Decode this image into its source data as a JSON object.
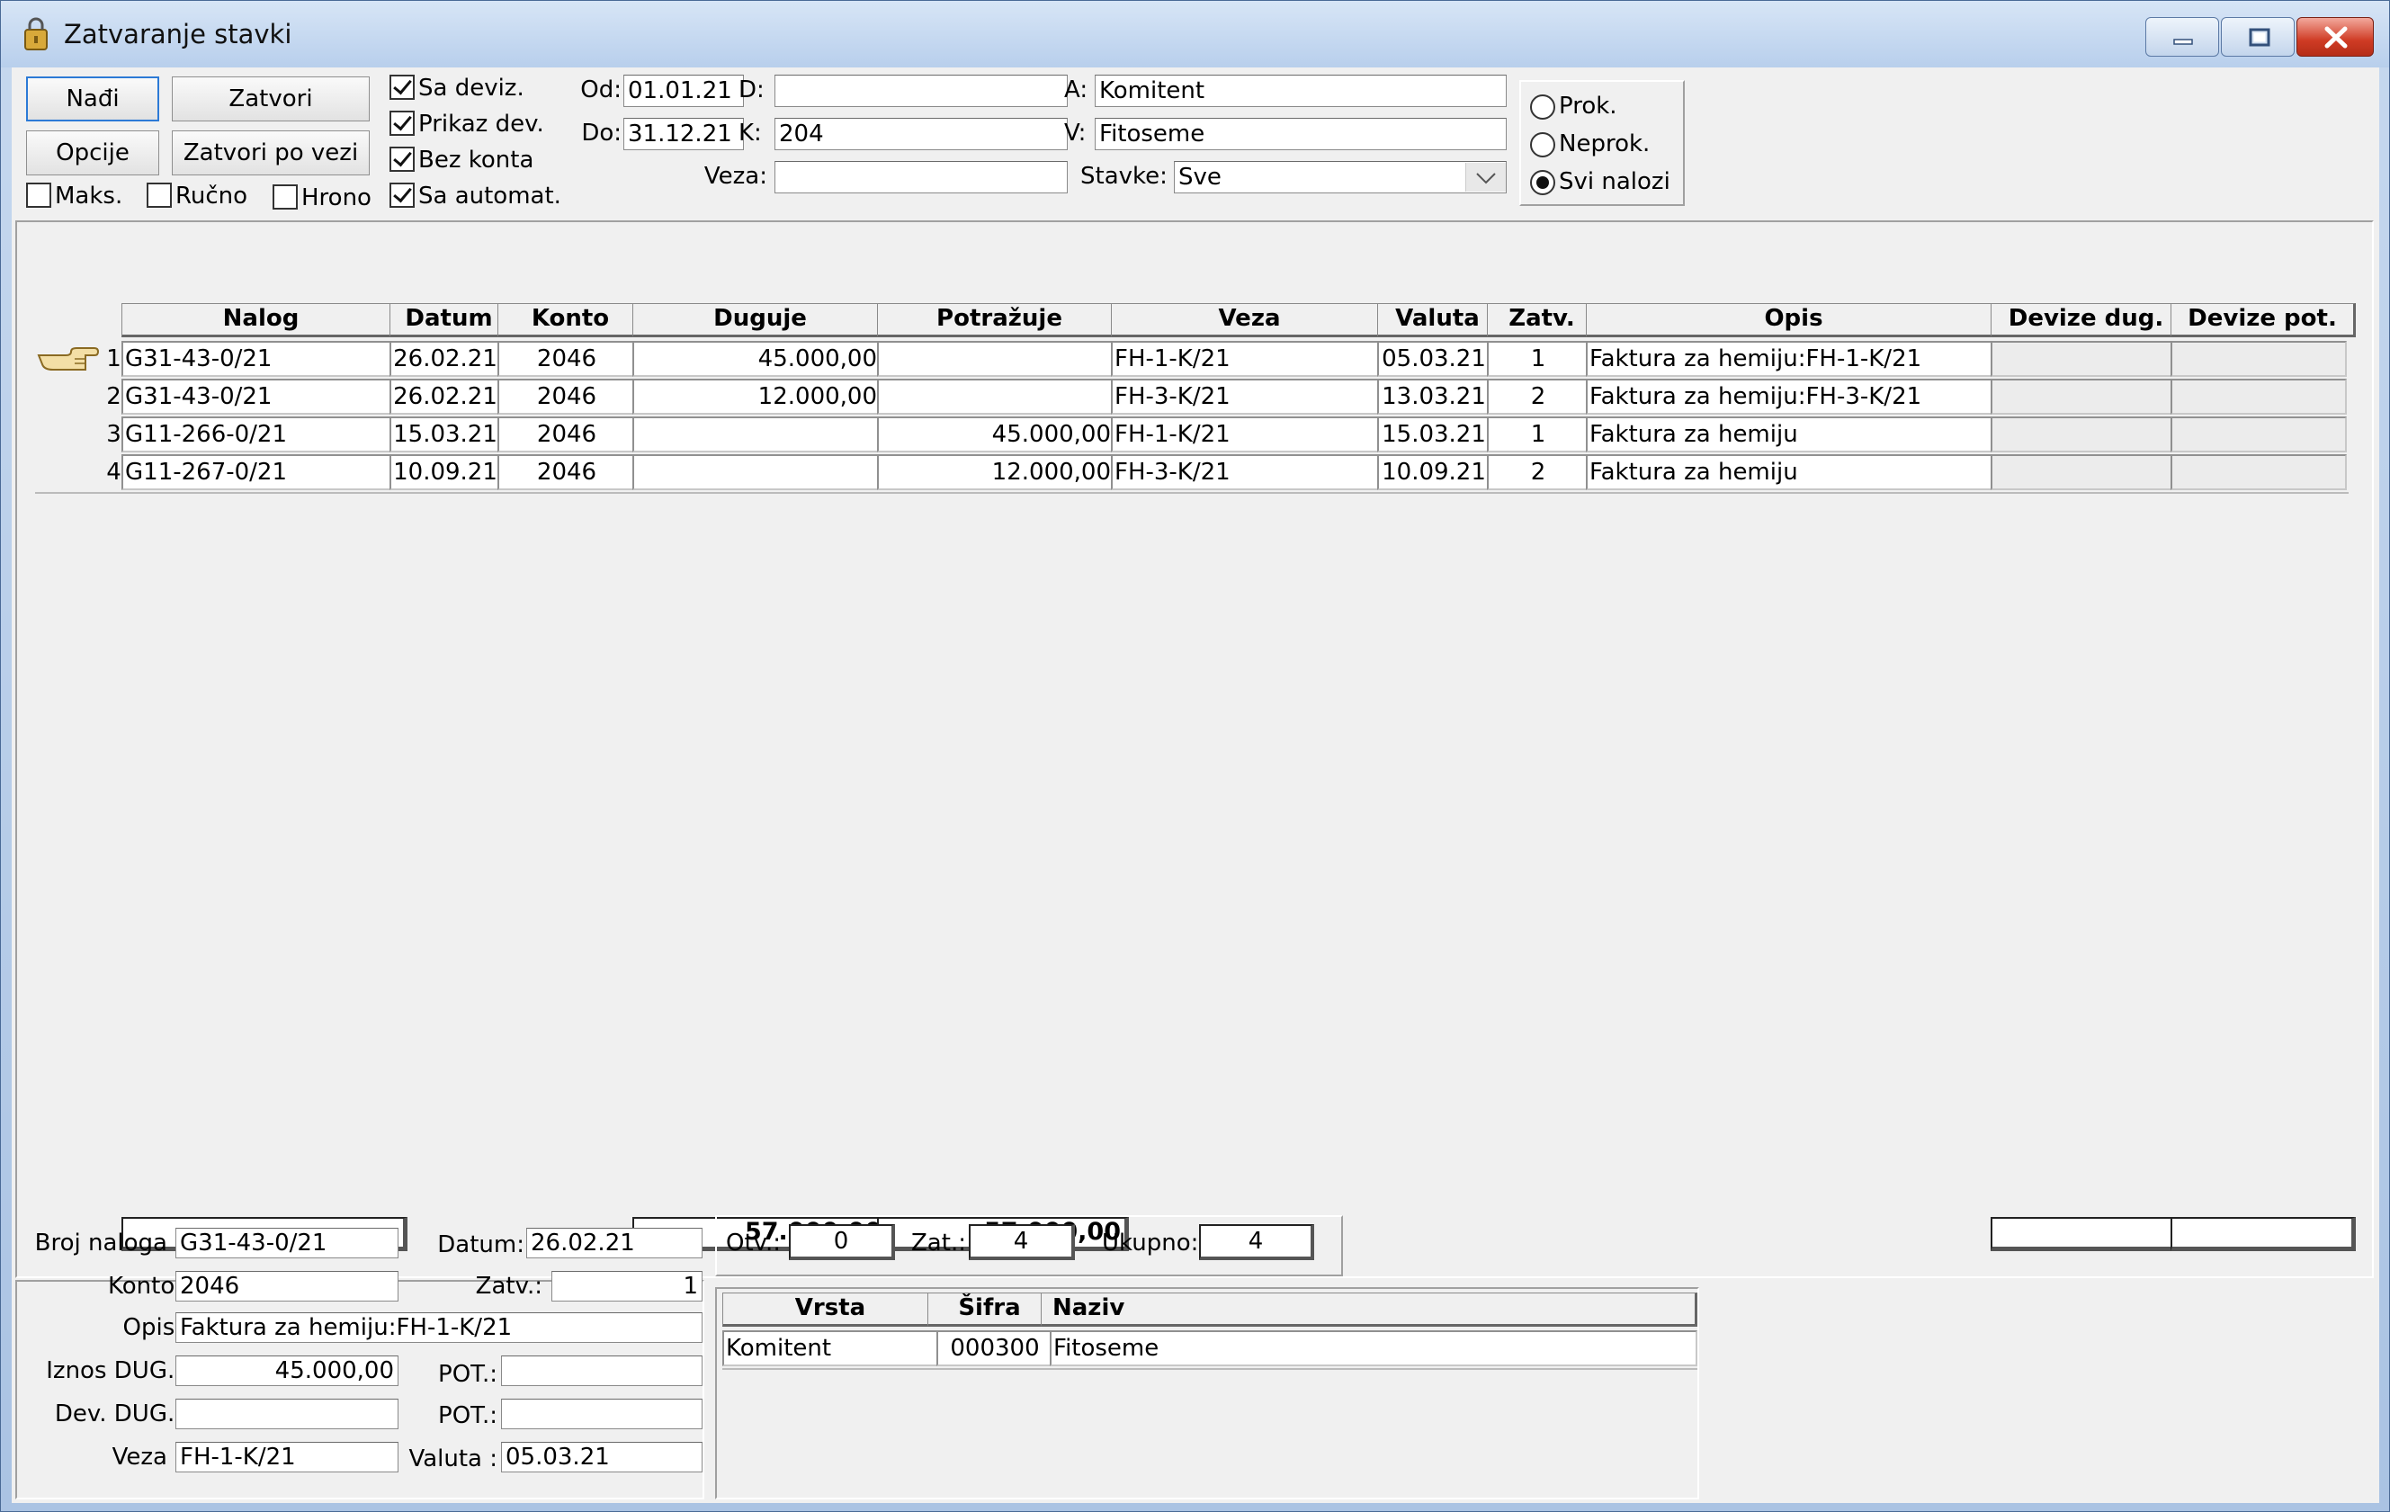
{
  "window": {
    "title": "Zatvaranje stavki"
  },
  "toolbar": {
    "nadji": "Nađi",
    "zatvori": "Zatvori",
    "opcije": "Opcije",
    "zatvori_po_vezi": "Zatvori po vezi"
  },
  "options": {
    "maks": "Maks.",
    "rucno": "Ručno",
    "hrono": "Hrono",
    "sa_deviz": "Sa deviz.",
    "prikaz_dev": "Prikaz dev.",
    "bez_konta": "Bez konta",
    "sa_automat": "Sa automat."
  },
  "filters": {
    "od_label": "Od:",
    "od": "01.01.21",
    "do_label": "Do:",
    "do": "31.12.21",
    "d_label": "D:",
    "d": "",
    "k_label": "K:",
    "k": "204",
    "veza_label": "Veza:",
    "veza": "",
    "a_label": "A:",
    "a": "Komitent",
    "v_label": "V:",
    "v": "Fitoseme",
    "stavke_label": "Stavke:",
    "stavke": "Sve"
  },
  "radios": {
    "prok": "Prok.",
    "neprok": "Neprok.",
    "svi": "Svi nalozi"
  },
  "grid": {
    "headers": [
      "Nalog",
      "Datum",
      "Konto",
      "Duguje",
      "Potražuje",
      "Veza",
      "Valuta",
      "Zatv.",
      "Opis",
      "Devize dug.",
      "Devize pot."
    ],
    "rows": [
      {
        "num": "1.",
        "nalog": "G31-43-0/21",
        "datum": "26.02.21",
        "konto": "2046",
        "duguje": "45.000,00",
        "potrazuje": "",
        "veza": "FH-1-K/21",
        "valuta": "05.03.21",
        "zatv": "1",
        "opis": "Faktura za hemiju:FH-1-K/21"
      },
      {
        "num": "2.",
        "nalog": "G31-43-0/21",
        "datum": "26.02.21",
        "konto": "2046",
        "duguje": "12.000,00",
        "potrazuje": "",
        "veza": "FH-3-K/21",
        "valuta": "13.03.21",
        "zatv": "2",
        "opis": "Faktura za hemiju:FH-3-K/21"
      },
      {
        "num": "3.",
        "nalog": "G11-266-0/21",
        "datum": "15.03.21",
        "konto": "2046",
        "duguje": "",
        "potrazuje": "45.000,00",
        "veza": "FH-1-K/21",
        "valuta": "15.03.21",
        "zatv": "1",
        "opis": "Faktura za hemiju"
      },
      {
        "num": "4.",
        "nalog": "G11-267-0/21",
        "datum": "10.09.21",
        "konto": "2046",
        "duguje": "",
        "potrazuje": "12.000,00",
        "veza": "FH-3-K/21",
        "valuta": "10.09.21",
        "zatv": "2",
        "opis": "Faktura za hemiju"
      }
    ],
    "total_duguje": "57.000,00",
    "total_potrazuje": "57.000,00"
  },
  "detail": {
    "broj_naloga_label": "Broj naloga :",
    "broj_naloga": "G31-43-0/21",
    "datum_label": "Datum:",
    "datum": "26.02.21",
    "konto_label": "Konto:",
    "konto": "2046",
    "zatv_label": "Zatv.:",
    "zatv": "1",
    "opis_label": "Opis:",
    "opis": "Faktura za hemiju:FH-1-K/21",
    "iznos_dug_label": "Iznos DUG.:",
    "iznos_dug": "45.000,00",
    "pot_label": "POT.:",
    "pot": "",
    "dev_dug_label": "Dev. DUG.:",
    "dev_dug": "",
    "dev_pot_label": "POT.:",
    "dev_pot": "",
    "veza_label": "Veza :",
    "veza": "FH-1-K/21",
    "valuta_label": "Valuta :",
    "valuta": "05.03.21"
  },
  "counts": {
    "otv_label": "Otv.:",
    "otv": "0",
    "zat_label": "Zat.:",
    "zat": "4",
    "ukupno_label": "Ukupno:",
    "ukupno": "4"
  },
  "analytics": {
    "headers": [
      "Vrsta",
      "Šifra",
      "Naziv"
    ],
    "rows": [
      {
        "vrsta": "Komitent",
        "sifra": "000300",
        "naziv": "Fitoseme"
      }
    ]
  }
}
